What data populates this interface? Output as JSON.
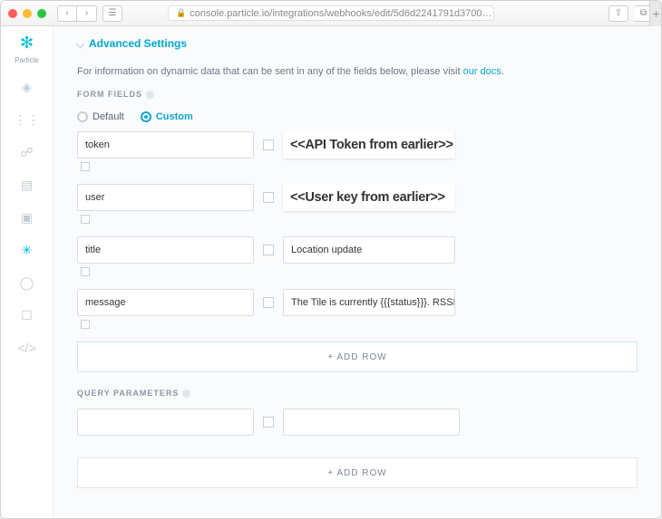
{
  "browser": {
    "url": "console.particle.io/integrations/webhooks/edit/5d6d2241791d3700…"
  },
  "brand": "Particle",
  "advanced_link": "Advanced Settings",
  "info_text_pre": "For information on dynamic data that can be sent in any of the fields below, please visit ",
  "info_link": "our docs",
  "info_text_post": ".",
  "form_fields_label": "FORM FIELDS",
  "radios": {
    "default": "Default",
    "custom": "Custom",
    "selected": "custom"
  },
  "rows": [
    {
      "key": "token",
      "value": "<<API Token from earlier>>",
      "big": true
    },
    {
      "key": "user",
      "value": "<<User key from earlier>>",
      "big": true
    },
    {
      "key": "title",
      "value": "Location update",
      "big": false
    },
    {
      "key": "message",
      "value": "The Tile is currently {{{status}}}. RSSI: {{{la",
      "big": false
    }
  ],
  "add_row": "+ ADD ROW",
  "query_params_label": "QUERY PARAMETERS",
  "query_rows": [
    {
      "key": "",
      "value": ""
    }
  ]
}
